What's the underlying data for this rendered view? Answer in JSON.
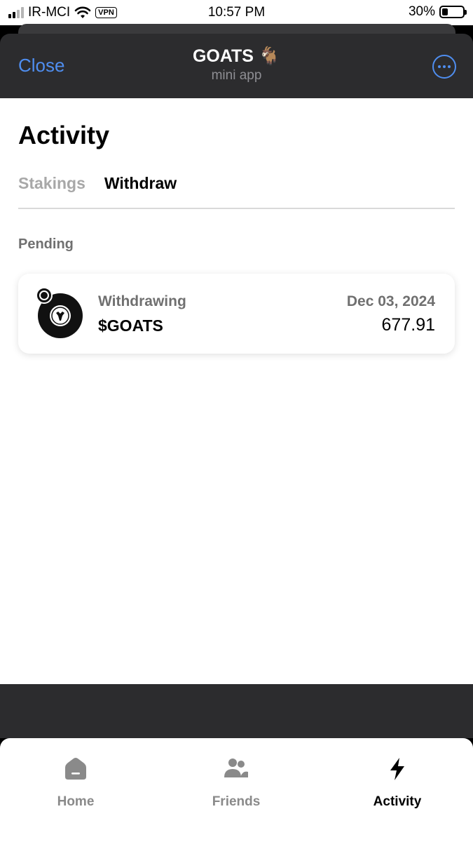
{
  "status_bar": {
    "carrier": "IR-MCI",
    "vpn": "VPN",
    "time": "10:57 PM",
    "battery": "30%",
    "battery_level": 0.3
  },
  "header": {
    "close_label": "Close",
    "title": "GOATS 🐐",
    "subtitle": "mini app",
    "more_icon": "more-horizontal-circle-icon",
    "accent_color": "#4f8ef0"
  },
  "main": {
    "title": "Activity",
    "tabs": [
      {
        "label": "Stakings",
        "active": false
      },
      {
        "label": "Withdraw",
        "active": true
      }
    ],
    "section_label": "Pending",
    "transaction": {
      "status": "Withdrawing",
      "token": "$GOATS",
      "date": "Dec 03, 2024",
      "amount": "677.91",
      "icon": "goats-token-icon"
    }
  },
  "bottom_nav": {
    "items": [
      {
        "label": "Home",
        "icon": "home-icon",
        "active": false
      },
      {
        "label": "Friends",
        "icon": "friends-icon",
        "active": false
      },
      {
        "label": "Activity",
        "icon": "lightning-icon",
        "active": true
      }
    ]
  }
}
